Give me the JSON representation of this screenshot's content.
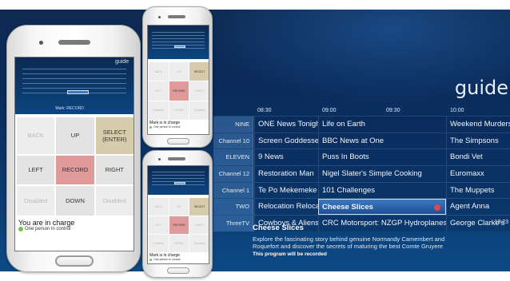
{
  "guide": {
    "title": "guide",
    "times": [
      "08:30",
      "09:00",
      "09:30",
      "10:00"
    ],
    "rows": [
      {
        "channel": "NINE",
        "programs": [
          {
            "title": "ONE News Tonight"
          },
          {
            "title": "Life on Earth"
          },
          {
            "title": "Weekend Murders"
          }
        ]
      },
      {
        "channel": "Channel 10",
        "programs": [
          {
            "title": "Screen Goddesses"
          },
          {
            "title": "BBC News at One"
          },
          {
            "title": "The Simpsons"
          }
        ]
      },
      {
        "channel": "ELEVEN",
        "programs": [
          {
            "title": "9 News"
          },
          {
            "title": "Puss In Boots"
          },
          {
            "title": "Bondi Vet"
          }
        ]
      },
      {
        "channel": "Channel 12",
        "programs": [
          {
            "title": "Restoration Man"
          },
          {
            "title": "Nigel Slater's Simple Cooking"
          },
          {
            "title": "Euromaxx"
          }
        ]
      },
      {
        "channel": "Channel 1",
        "programs": [
          {
            "title": "Te Po Mekemeke"
          },
          {
            "title": "101 Challenges"
          },
          {
            "title": "The Muppets"
          }
        ]
      },
      {
        "channel": "TWO",
        "programs": [
          {
            "title": "Relocation Relocation"
          },
          {
            "title": "Cheese Slices",
            "selected": true,
            "recording": true
          },
          {
            "title": "Agent Anna"
          }
        ]
      },
      {
        "channel": "ThreeTV",
        "programs": [
          {
            "title": "Cowboys & Aliens"
          },
          {
            "title": "CRC Motorsport: NZGP Hydroplanes"
          },
          {
            "title": "George Clarke's"
          }
        ]
      }
    ],
    "clock": "19:23",
    "details": {
      "title": "Cheese Slices",
      "description": "Explore the fascinating story behind genuine Normandy Camembert and Roquefort and discover the secrets of maturing the best Comte Gruyere",
      "record_status": "This program will be recorded"
    }
  },
  "remote_main": {
    "guide_label": "guide",
    "mark_label": "Mark: RECORD",
    "buttons": [
      {
        "label": "BACK",
        "state": "dim"
      },
      {
        "label": "UP",
        "state": "normal"
      },
      {
        "label": "SELECT (ENTER)",
        "state": "select"
      },
      {
        "label": "LEFT",
        "state": "normal"
      },
      {
        "label": "RECORD",
        "state": "record"
      },
      {
        "label": "RIGHT",
        "state": "normal"
      },
      {
        "label": "Disabled",
        "state": "dim"
      },
      {
        "label": "DOWN",
        "state": "normal"
      },
      {
        "label": "Disabled",
        "state": "dim"
      }
    ],
    "status": "You are in charge",
    "control": "One person in control"
  },
  "remote_small_top": {
    "buttons": [
      {
        "label": "BACK",
        "state": "dim"
      },
      {
        "label": "UP",
        "state": "dim"
      },
      {
        "label": "SELECT",
        "state": "select"
      },
      {
        "label": "LEFT",
        "state": "dim"
      },
      {
        "label": "RECORD",
        "state": "record"
      },
      {
        "label": "RIGHT",
        "state": "dim"
      },
      {
        "label": "Disabled",
        "state": "dim"
      },
      {
        "label": "DOWN",
        "state": "dim"
      },
      {
        "label": "Disabled",
        "state": "dim"
      }
    ],
    "status": "Mark is in charge",
    "control": "One person in control"
  },
  "remote_small_bottom": {
    "buttons": [
      {
        "label": "BACK",
        "state": "dim"
      },
      {
        "label": "UP",
        "state": "dim"
      },
      {
        "label": "SELECT",
        "state": "select"
      },
      {
        "label": "LEFT",
        "state": "dim"
      },
      {
        "label": "RECORD",
        "state": "record"
      },
      {
        "label": "RIGHT",
        "state": "dim"
      },
      {
        "label": "Disabled",
        "state": "dim"
      },
      {
        "label": "DOWN",
        "state": "dim"
      },
      {
        "label": "Disabled",
        "state": "dim"
      }
    ],
    "status": "Mark is in charge",
    "control": "One person in control"
  }
}
